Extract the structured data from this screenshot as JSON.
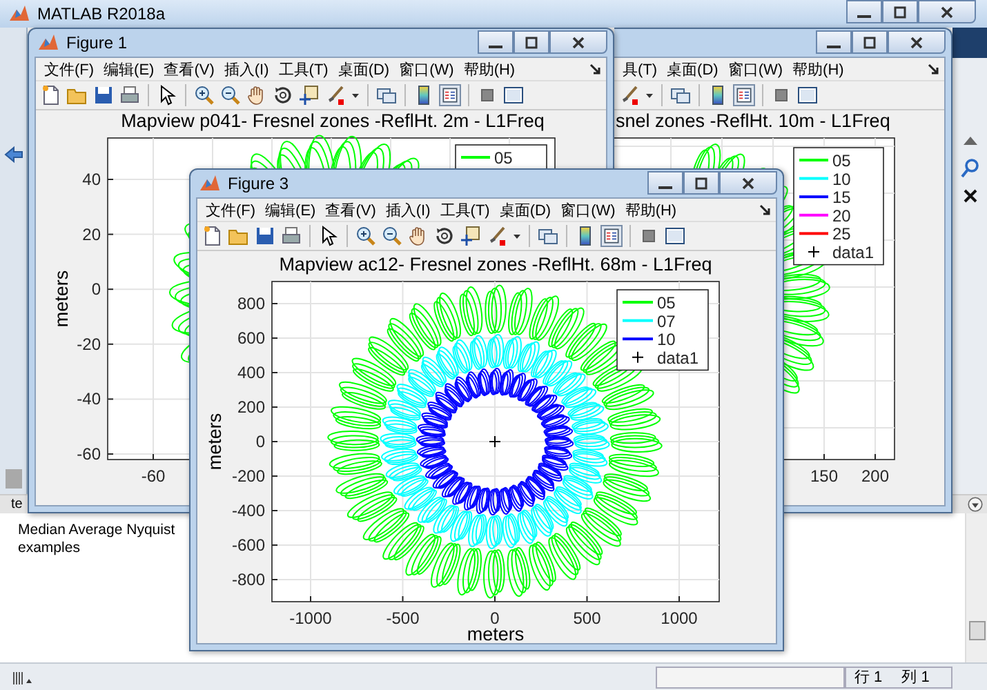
{
  "main_window": {
    "title": "MATLAB R2018a"
  },
  "figure_2": {
    "menu": [
      "具(T)",
      "桌面(D)",
      "窗口(W)",
      "帮助(H)"
    ],
    "plot": {
      "title": "snel zones -ReflHt. 10m - L1Freq",
      "xticks": [
        "150",
        "200"
      ],
      "legend": [
        {
          "label": "05",
          "color": "#00ff00",
          "kind": "line"
        },
        {
          "label": "10",
          "color": "#00ffff",
          "kind": "line"
        },
        {
          "label": "15",
          "color": "#0000ff",
          "kind": "line"
        },
        {
          "label": "20",
          "color": "#ff00ff",
          "kind": "line"
        },
        {
          "label": "25",
          "color": "#ff0000",
          "kind": "line"
        },
        {
          "label": "data1",
          "color": "#000000",
          "kind": "marker"
        }
      ]
    }
  },
  "figure_1": {
    "title": "Figure 1",
    "menu": [
      "文件(F)",
      "编辑(E)",
      "查看(V)",
      "插入(I)",
      "工具(T)",
      "桌面(D)",
      "窗口(W)",
      "帮助(H)"
    ],
    "plot": {
      "title": "Mapview p041- Fresnel zones -ReflHt. 2m - L1Freq",
      "ylabel": "meters",
      "yticks": [
        "40",
        "20",
        "0",
        "-20",
        "-40",
        "-60"
      ],
      "xticks": [
        "-60"
      ],
      "legend": [
        {
          "label": "05",
          "color": "#00ff00",
          "kind": "line"
        }
      ]
    }
  },
  "figure_3": {
    "title": "Figure 3",
    "menu": [
      "文件(F)",
      "编辑(E)",
      "查看(V)",
      "插入(I)",
      "工具(T)",
      "桌面(D)",
      "窗口(W)",
      "帮助(H)"
    ],
    "plot": {
      "title": "Mapview ac12- Fresnel zones -ReflHt. 68m - L1Freq",
      "xlabel": "meters",
      "ylabel": "meters",
      "yticks": [
        "800",
        "600",
        "400",
        "200",
        "0",
        "-200",
        "-400",
        "-600",
        "-800"
      ],
      "xticks": [
        "-1000",
        "-500",
        "0",
        "500",
        "1000"
      ],
      "legend": [
        {
          "label": "05",
          "color": "#00ff00",
          "kind": "line"
        },
        {
          "label": "07",
          "color": "#00ffff",
          "kind": "line"
        },
        {
          "label": "10",
          "color": "#0000ff",
          "kind": "line"
        },
        {
          "label": "data1",
          "color": "#000000",
          "kind": "marker"
        }
      ]
    }
  },
  "workspace_panel": {
    "tab_label": "te",
    "description": "Median Average Nyquist examples"
  },
  "status_bar": {
    "row": "行 1",
    "column": "列 1"
  }
}
